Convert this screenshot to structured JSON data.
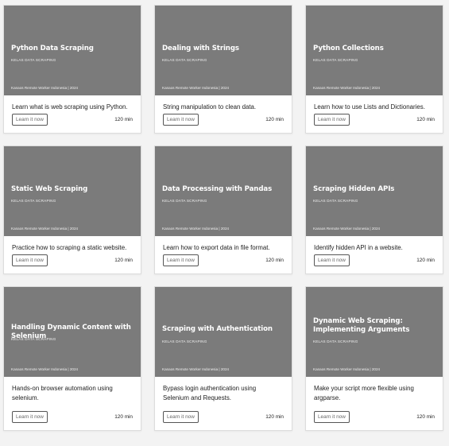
{
  "courses": [
    {
      "title": "Python Data Scraping",
      "category": "KELAS DATA SCRAPING",
      "footer": "Kanaos Remote Worker Indonesia | 2024",
      "description": "Learn what is web scraping using Python.",
      "button_label": "Learn it now",
      "duration": "120 min"
    },
    {
      "title": "Dealing with Strings",
      "category": "KELAS DATA SCRAPING",
      "footer": "Kanaos Remote Worker Indonesia | 2024",
      "description": "String manipulation to clean data.",
      "button_label": "Learn it now",
      "duration": "120 min"
    },
    {
      "title": "Python Collections",
      "category": "KELAS DATA SCRAPING",
      "footer": "Kanaos Remote Worker Indonesia | 2024",
      "description": "Learn how to use Lists and Dictionaries.",
      "button_label": "Learn it now",
      "duration": "120 min"
    },
    {
      "title": "Static Web Scraping",
      "category": "KELAS DATA SCRAPING",
      "footer": "Kanaos Remote Worker Indonesia | 2024",
      "description": "Practice how to scraping a static website.",
      "button_label": "Learn it now",
      "duration": "120 min"
    },
    {
      "title": "Data Processing with Pandas",
      "category": "KELAS DATA SCRAPING",
      "footer": "Kanaos Remote Worker Indonesia | 2024",
      "description": "Learn how to export data in file format.",
      "button_label": "Learn it now",
      "duration": "120 min"
    },
    {
      "title": "Scraping Hidden APIs",
      "category": "KELAS DATA SCRAPING",
      "footer": "Kanaos Remote Worker Indonesia | 2024",
      "description": "Identify hidden API in a website.",
      "button_label": "Learn it now",
      "duration": "120 min"
    },
    {
      "title": "Handling Dynamic Content with Selenium",
      "category": "KELAS DATA SCRAPING",
      "footer": "Kanaos Remote Worker Indonesia | 2024",
      "description": "Hands-on browser automation using selenium.",
      "button_label": "Learn it now",
      "duration": "120 min"
    },
    {
      "title": "Scraping with Authentication",
      "category": "KELAS DATA SCRAPING",
      "footer": "Kanaos Remote Worker Indonesia | 2024",
      "description": "Bypass login authentication using Selenium and Requests.",
      "button_label": "Learn it now",
      "duration": "120 min"
    },
    {
      "title": "Dynamic Web Scraping: Implementing Arguments",
      "category": "KELAS DATA SCRAPING",
      "footer": "Kanaos Remote Worker Indonesia | 2024",
      "description": "Make your script more flexible using argparse.",
      "button_label": "Learn it now",
      "duration": "120 min"
    }
  ],
  "colors": {
    "thumbnail_bg": "#7b7b7b",
    "page_bg": "#f3f3f3",
    "card_bg": "#ffffff"
  }
}
